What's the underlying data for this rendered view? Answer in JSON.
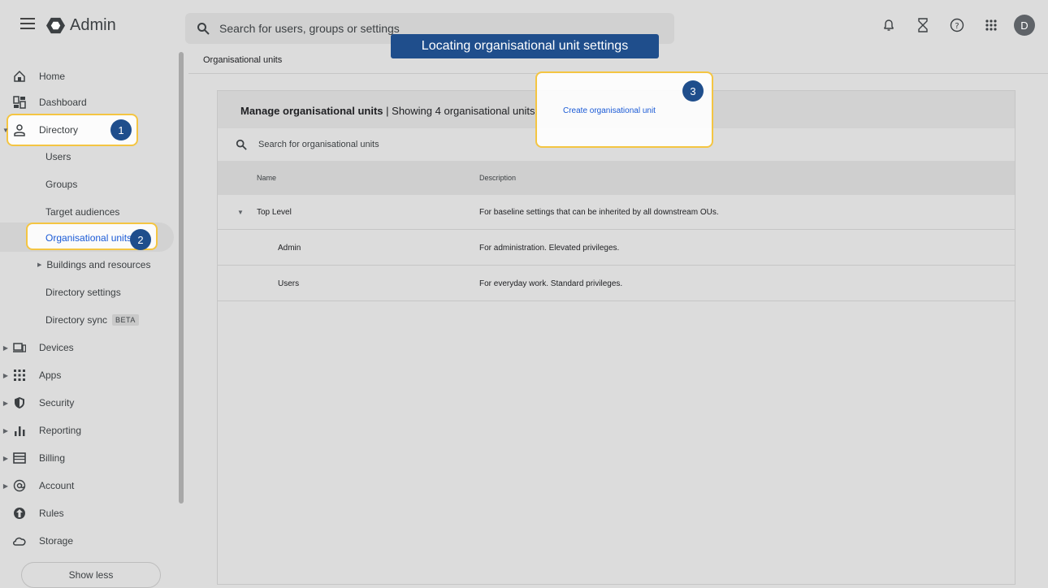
{
  "app": {
    "name": "Admin"
  },
  "search": {
    "placeholder": "Search for users, groups or settings"
  },
  "tutorial": {
    "banner": "Locating organisational unit settings",
    "steps": [
      "1",
      "2",
      "3"
    ]
  },
  "header": {
    "avatar_letter": "D"
  },
  "icons": {
    "menu": "menu-icon",
    "logo": "admin-logo-icon",
    "search": "search-icon",
    "bell": "bell-icon",
    "hourglass": "hourglass-icon",
    "help": "help-icon",
    "apps": "apps-grid-icon"
  },
  "sidebar": {
    "items": [
      {
        "label": "Home",
        "icon": "home-icon"
      },
      {
        "label": "Dashboard",
        "icon": "dashboard-icon"
      },
      {
        "label": "Directory",
        "icon": "person-icon",
        "expanded": true
      },
      {
        "label": "Devices",
        "icon": "devices-icon"
      },
      {
        "label": "Apps",
        "icon": "apps-icon"
      },
      {
        "label": "Security",
        "icon": "shield-icon"
      },
      {
        "label": "Reporting",
        "icon": "bar-chart-icon"
      },
      {
        "label": "Billing",
        "icon": "card-icon"
      },
      {
        "label": "Account",
        "icon": "at-icon"
      },
      {
        "label": "Rules",
        "icon": "rules-icon"
      },
      {
        "label": "Storage",
        "icon": "cloud-icon"
      }
    ],
    "directory_children": [
      "Users",
      "Groups",
      "Target audiences",
      "Organisational units",
      "Buildings and resources",
      "Directory settings",
      "Directory sync"
    ],
    "beta_badge": "BETA",
    "show_less": "Show less"
  },
  "breadcrumb": "Organisational units",
  "panel": {
    "title": "Manage organisational units",
    "subtitle": "| Showing 4 organisational units",
    "create_link": "Create organisational unit",
    "search_placeholder": "Search for organisational units",
    "columns": [
      "Name",
      "Description"
    ],
    "rows": [
      {
        "name": "Top Level",
        "description": "For baseline settings that can be inherited by all downstream OUs."
      },
      {
        "name": "Admin",
        "description": "For administration. Elevated privileges."
      },
      {
        "name": "Users",
        "description": "For everyday work. Standard privileges."
      }
    ]
  },
  "colors": {
    "accent": "#1f4e8c",
    "highlight": "#f4c542",
    "link": "#1a5ad6"
  }
}
